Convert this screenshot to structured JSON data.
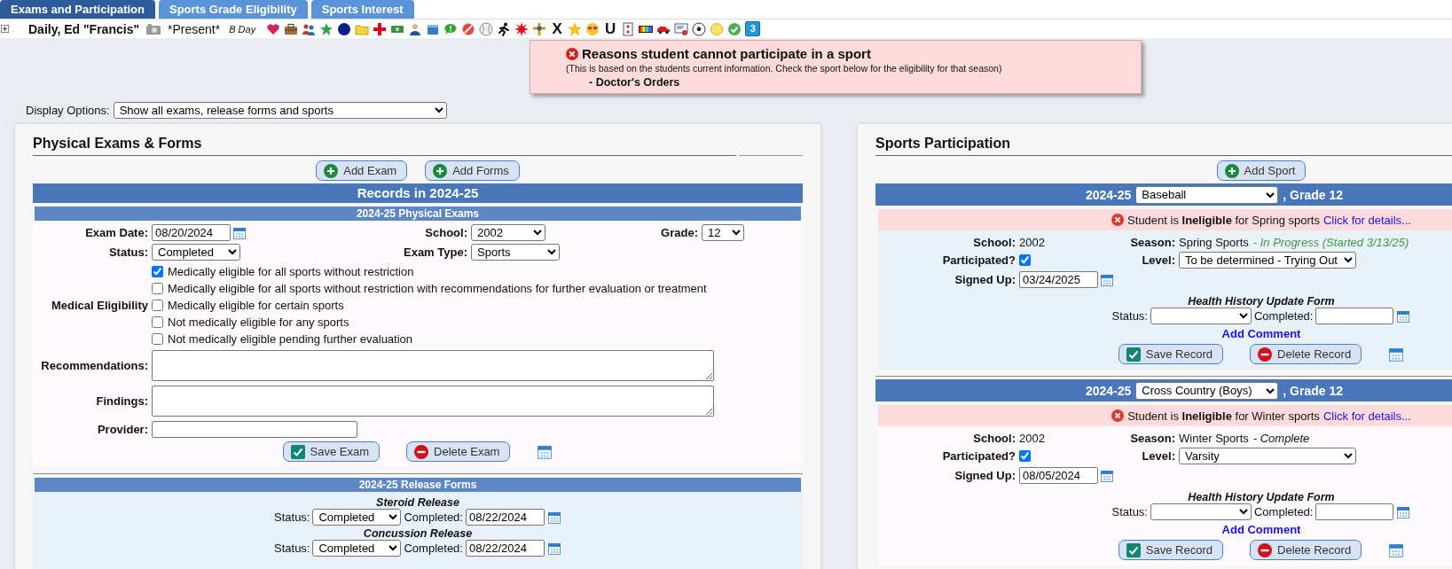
{
  "tabs": [
    {
      "label": "Exams and Participation",
      "selected": true
    },
    {
      "label": "Sports Grade Eligibility",
      "selected": false
    },
    {
      "label": "Sports Interest",
      "selected": false
    }
  ],
  "student": {
    "name": "Daily, Ed \"Francis\"",
    "attendance": "*Present*",
    "day": "B Day",
    "flags": [
      {
        "kind": "heart"
      },
      {
        "kind": "briefcase"
      },
      {
        "kind": "people"
      },
      {
        "kind": "green_star"
      },
      {
        "kind": "navy_dot"
      },
      {
        "kind": "folder"
      },
      {
        "kind": "red_cross"
      },
      {
        "kind": "money"
      },
      {
        "kind": "person"
      },
      {
        "kind": "box"
      },
      {
        "kind": "speech"
      },
      {
        "kind": "prohibited"
      },
      {
        "kind": "baseball"
      },
      {
        "kind": "runner"
      },
      {
        "kind": "burst"
      },
      {
        "kind": "cross_figure"
      },
      {
        "kind": "letter",
        "text": "X"
      },
      {
        "kind": "yellow_star"
      },
      {
        "kind": "emoji"
      },
      {
        "kind": "letter",
        "text": "U"
      },
      {
        "kind": "card"
      },
      {
        "kind": "rainbow"
      },
      {
        "kind": "car"
      },
      {
        "kind": "certificate"
      },
      {
        "kind": "soccer"
      },
      {
        "kind": "yellow_dot"
      },
      {
        "kind": "check"
      },
      {
        "kind": "badge",
        "text": "3"
      }
    ]
  },
  "alert": {
    "title": "Reasons student cannot participate in a sport",
    "note": "(This is based on the students current information. Check the sport below for the eligibility for that season)",
    "reasons": [
      "- Doctor's Orders"
    ]
  },
  "display_options": {
    "label": "Display Options:",
    "value": "Show all exams, release forms and sports"
  },
  "exams": {
    "title": "Physical Exams & Forms",
    "buttons": [
      {
        "label": "Add Exam",
        "kind": "add"
      },
      {
        "label": "Add Forms",
        "kind": "add"
      }
    ],
    "records_heading": "Records in 2024-25",
    "physical": {
      "heading": "2024-25 Physical Exams",
      "exam_date": {
        "label": "Exam Date:",
        "value": "08/20/2024"
      },
      "school": {
        "label": "School:",
        "value": "2002"
      },
      "grade": {
        "label": "Grade:",
        "value": "12"
      },
      "status": {
        "label": "Status:",
        "value": "Completed"
      },
      "exam_type": {
        "label": "Exam Type:",
        "value": "Sports"
      },
      "medical_eligibility": {
        "label": "Medical Eligibility",
        "options": [
          {
            "text": "Medically eligible for all sports without restriction",
            "checked": true
          },
          {
            "text": "Medically eligible for all sports without restriction with recommendations for further evaluation or treatment",
            "checked": false
          },
          {
            "text": "Medically eligible for certain sports",
            "checked": false
          },
          {
            "text": "Not medically eligible for any sports",
            "checked": false
          },
          {
            "text": "Not medically eligible pending further evaluation",
            "checked": false
          }
        ]
      },
      "recommendations": {
        "label": "Recommendations:"
      },
      "findings": {
        "label": "Findings:"
      },
      "provider": {
        "label": "Provider:"
      },
      "buttons": [
        {
          "label": "Save Exam",
          "kind": "save"
        },
        {
          "label": "Delete Exam",
          "kind": "delete"
        }
      ]
    },
    "release": {
      "heading": "2024-25 Release Forms",
      "forms": [
        {
          "title": "Steroid Release",
          "status_label": "Status:",
          "status": "Completed",
          "completed_label": "Completed:",
          "completed": "08/22/2024"
        },
        {
          "title": "Concussion Release",
          "status_label": "Status:",
          "status": "Completed",
          "completed_label": "Completed:",
          "completed": "08/22/2024"
        }
      ]
    }
  },
  "sports": {
    "title": "Sports Participation",
    "add_button": {
      "label": "Add Sport",
      "kind": "add"
    },
    "records": [
      {
        "year": "2024-25",
        "sport": "Baseball",
        "grade": ", Grade 12",
        "eligibility": "Student is **Ineligible** for Spring sports",
        "details_link": "Click for details...",
        "school_label": "School:",
        "school": "2002",
        "season_label": "Season:",
        "season": "Spring Sports",
        "season_status": "- In Progress (Started 3/13/25)",
        "kind": "in_progress",
        "participated_label": "Participated?",
        "participated": true,
        "level_label": "Level:",
        "level": "To be determined - Trying Out",
        "signed_up_label": "Signed Up:",
        "signed_up": "03/24/2025",
        "form_title": "Health History Update Form",
        "status_label": "Status:",
        "completed_label": "Completed:",
        "comment_link": "Add Comment",
        "buttons": [
          {
            "label": "Save Record",
            "kind": "save"
          },
          {
            "label": "Delete Record",
            "kind": "delete"
          }
        ]
      },
      {
        "year": "2024-25",
        "sport": "Cross Country (Boys)",
        "grade": ", Grade 12",
        "eligibility": "Student is **Ineligible** for Winter sports",
        "details_link": "Click for details...",
        "school_label": "School:",
        "school": "2002",
        "season_label": "Season:",
        "season": "Winter Sports",
        "season_status": "- Complete",
        "kind": "complete",
        "participated_label": "Participated?",
        "participated": true,
        "level_label": "Level:",
        "level": "Varsity",
        "signed_up_label": "Signed Up:",
        "signed_up": "08/05/2024",
        "form_title": "Health History Update Form",
        "status_label": "Status:",
        "completed_label": "Completed:",
        "comment_link": "Add Comment",
        "buttons": [
          {
            "label": "Save Record",
            "kind": "save"
          },
          {
            "label": "Delete Record",
            "kind": "delete"
          }
        ]
      }
    ]
  }
}
